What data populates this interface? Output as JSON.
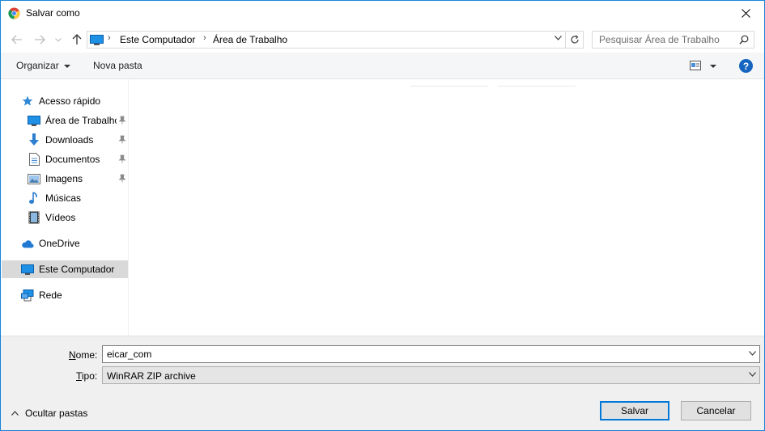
{
  "window": {
    "title": "Salvar como"
  },
  "address": {
    "crumbs": [
      "Este Computador",
      "Área de Trabalho"
    ],
    "search_placeholder": "Pesquisar Área de Trabalho"
  },
  "toolbar": {
    "organize_label": "Organizar",
    "new_folder_label": "Nova pasta",
    "help_label": "?"
  },
  "nav": {
    "quick_access": "Acesso rápido",
    "desktop": "Área de Trabalho",
    "downloads": "Downloads",
    "documents": "Documentos",
    "pictures": "Imagens",
    "music": "Músicas",
    "videos": "Vídeos",
    "onedrive": "OneDrive",
    "this_pc": "Este Computador",
    "network": "Rede"
  },
  "form": {
    "name_label_key": "N",
    "name_label_rest": "ome:",
    "name_value": "eicar_com",
    "type_label_key": "T",
    "type_label_rest": "ipo:",
    "type_value": "WinRAR ZIP archive"
  },
  "footer": {
    "hide_folders": "Ocultar pastas",
    "save_label": "Salvar",
    "cancel_label": "Cancelar"
  },
  "colors": {
    "accent": "#0078d7",
    "selection": "#d9d9d9",
    "toolbar_bg": "#f5f6f7",
    "footer_bg": "#f0f0f0"
  }
}
